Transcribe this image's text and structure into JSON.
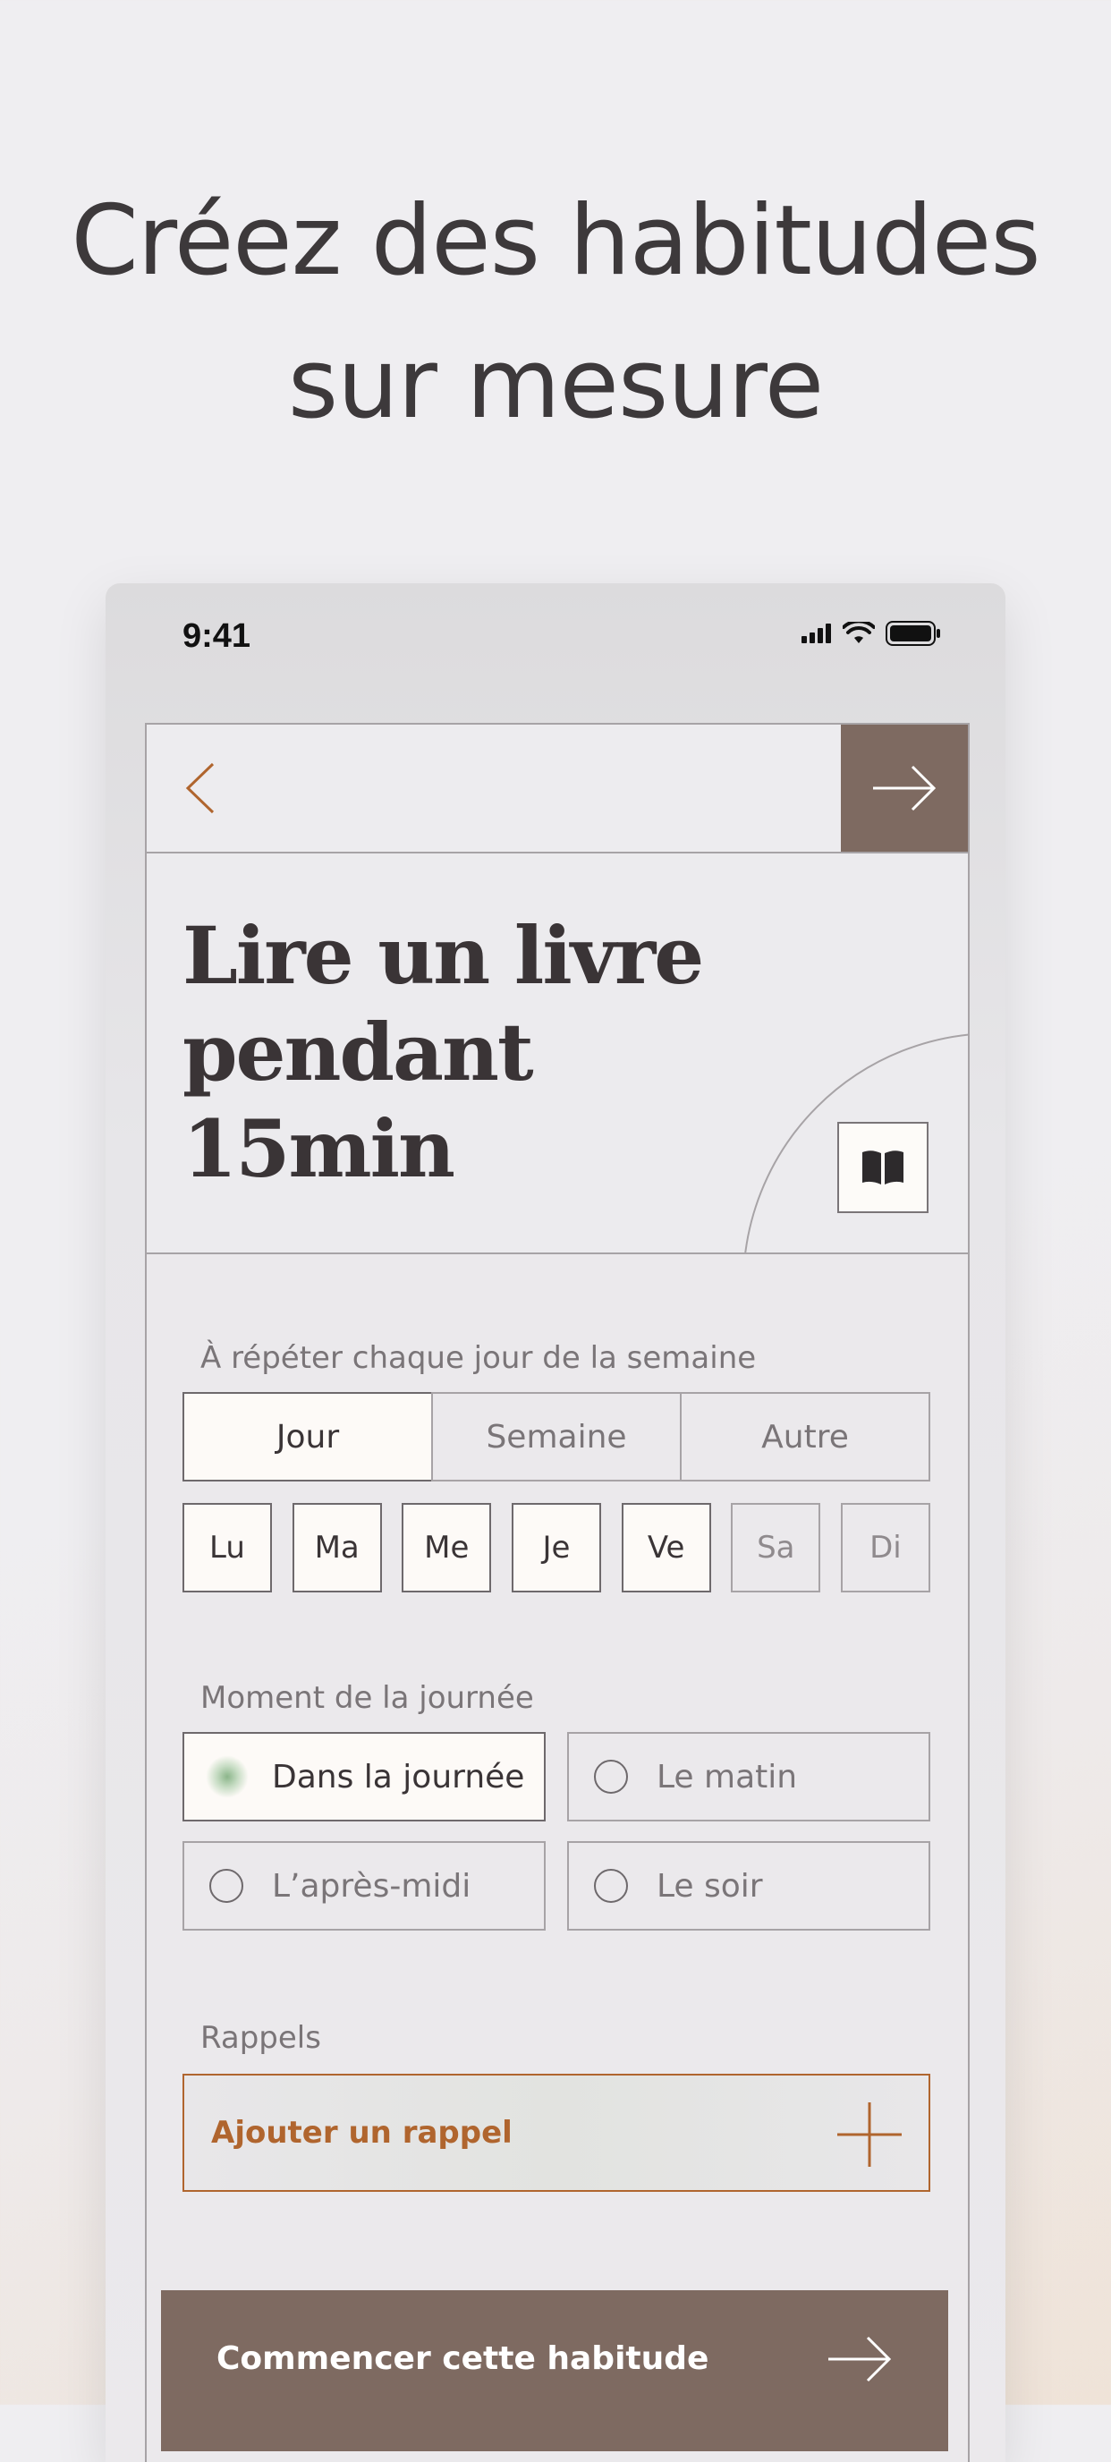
{
  "headline": {
    "line1": "Créez des habitudes",
    "line2": "sur mesure"
  },
  "status_bar": {
    "time": "9:41",
    "icons": [
      "signal-icon",
      "wifi-icon",
      "battery-icon"
    ]
  },
  "nav": {
    "back_icon": "chevron-left-icon",
    "next_icon": "arrow-right-icon"
  },
  "habit": {
    "title": "Lire un livre pendant 15min",
    "icon": "book-open-icon"
  },
  "repeat": {
    "label": "À répéter chaque jour de la semaine",
    "frequency_options": [
      "Jour",
      "Semaine",
      "Autre"
    ],
    "selected_frequency": "Jour",
    "days": [
      {
        "label": "Lu",
        "selected": true
      },
      {
        "label": "Ma",
        "selected": true
      },
      {
        "label": "Me",
        "selected": true
      },
      {
        "label": "Je",
        "selected": true
      },
      {
        "label": "Ve",
        "selected": true
      },
      {
        "label": "Sa",
        "selected": false
      },
      {
        "label": "Di",
        "selected": false
      }
    ]
  },
  "moment": {
    "label": "Moment de la journée",
    "options": [
      "Dans la journée",
      "Le matin",
      "L’après-midi",
      "Le soir"
    ],
    "selected": "Dans la journée"
  },
  "reminders": {
    "label": "Rappels",
    "add_label": "Ajouter un rappel",
    "add_icon": "plus-icon"
  },
  "cta": {
    "label": "Commencer cette habitude",
    "icon": "arrow-right-icon"
  },
  "colors": {
    "accent": "#7e6a61",
    "reminder": "#b0652e",
    "selected_bg": "#fdfaf7"
  }
}
